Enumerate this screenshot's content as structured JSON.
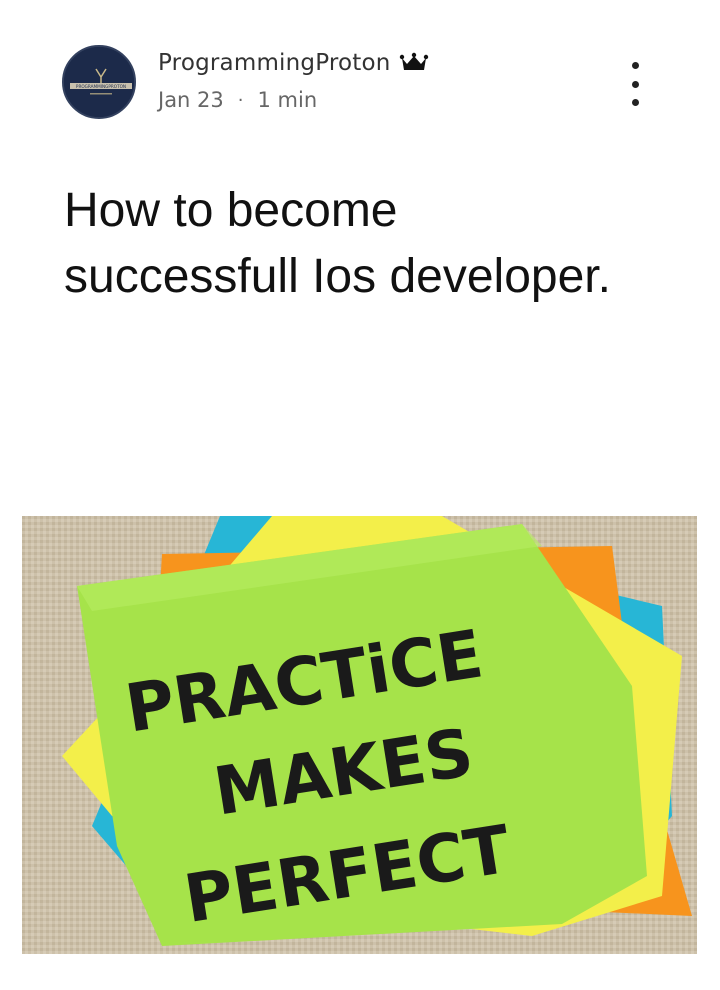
{
  "post": {
    "author": "ProgrammingProton",
    "author_badge_icon": "crown-icon",
    "date": "Jan 23",
    "separator": "·",
    "read_time": "1 min",
    "more_icon": "more-vertical-icon",
    "title": "How to become successfull Ios developer."
  },
  "avatar": {
    "logo_text": "PROGRAMMINGPROTON",
    "background": "#1c2a4a"
  },
  "cover_image": {
    "lines": [
      "PRACTiCE",
      "MAKES",
      "PERFECT"
    ],
    "note_colors": {
      "green": "#a6e34a",
      "yellow": "#f3ef4a",
      "orange": "#f7941d",
      "blue": "#27b6d6"
    }
  }
}
